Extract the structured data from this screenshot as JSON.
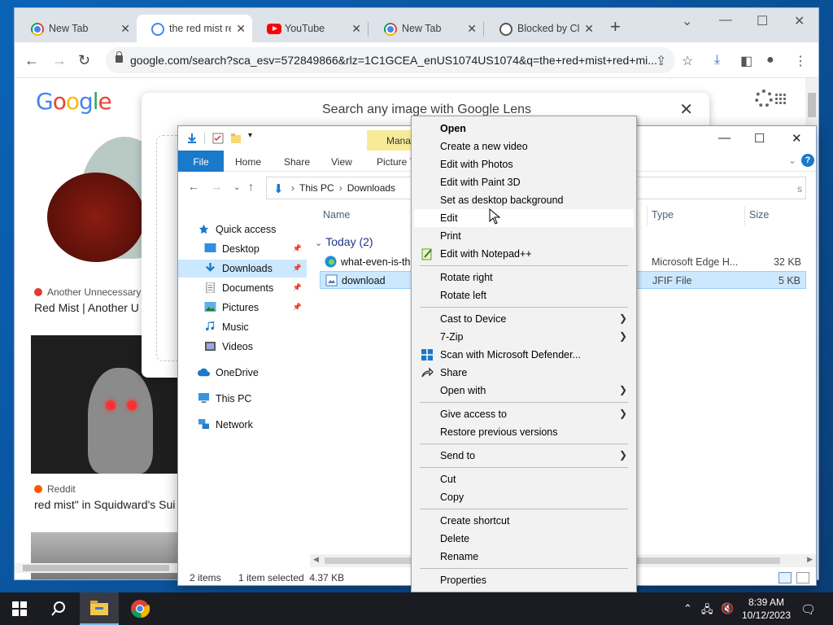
{
  "browser": {
    "tabs": [
      {
        "title": "New Tab",
        "icon": "chrome-icon"
      },
      {
        "title": "the red mist re",
        "icon": "google-icon"
      },
      {
        "title": "YouTube",
        "icon": "youtube-icon"
      },
      {
        "title": "New Tab",
        "icon": "chrome-icon"
      },
      {
        "title": "Blocked by Clo",
        "icon": "blocked-icon"
      }
    ],
    "url": "google.com/search?sca_esv=572849866&rlz=1C1GCEA_enUS1074US1074&q=the+red+mist+red+mi..."
  },
  "google": {
    "logo": [
      "G",
      "o",
      "o",
      "g",
      "l",
      "e"
    ],
    "lens_title": "Search any image with Google Lens",
    "result1_source": "Another Unnecessary",
    "result1_title": "Red Mist | Another U",
    "result2_source": "Reddit",
    "result2_title": "red mist\" in Squidward's Sui"
  },
  "explorer": {
    "ribbon_tabs": [
      "File",
      "Home",
      "Share",
      "View",
      "Picture T"
    ],
    "manage_label": "Manag",
    "address": {
      "this_pc": "This PC",
      "sep": "›",
      "folder": "Downloads"
    },
    "search_placeholder": "s",
    "nav": [
      {
        "label": "Quick access",
        "icon": "star-icon"
      },
      {
        "label": "Desktop",
        "icon": "desktop-icon"
      },
      {
        "label": "Downloads",
        "icon": "downloads-icon"
      },
      {
        "label": "Documents",
        "icon": "documents-icon"
      },
      {
        "label": "Pictures",
        "icon": "pictures-icon"
      },
      {
        "label": "Music",
        "icon": "music-icon"
      },
      {
        "label": "Videos",
        "icon": "videos-icon"
      },
      {
        "label": "OneDrive",
        "icon": "onedrive-icon"
      },
      {
        "label": "This PC",
        "icon": "computer-icon"
      },
      {
        "label": "Network",
        "icon": "network-icon"
      }
    ],
    "columns": {
      "name": "Name",
      "type": "Type",
      "size": "Size"
    },
    "group_label": "Today (2)",
    "files": [
      {
        "name": "what-even-is-the",
        "type": "Microsoft Edge H...",
        "size": "32 KB"
      },
      {
        "name": "download",
        "type": "JFIF File",
        "size": "5 KB"
      }
    ],
    "status": {
      "items": "2 items",
      "selected": "1 item selected  4.37 KB"
    }
  },
  "context_menu": {
    "items": [
      {
        "label": "Open"
      },
      {
        "label": "Create a new video"
      },
      {
        "label": "Edit with Photos"
      },
      {
        "label": "Edit with Paint 3D"
      },
      {
        "label": "Set as desktop background"
      },
      {
        "label": "Edit"
      },
      {
        "label": "Print"
      },
      {
        "label": "Edit with Notepad++"
      },
      {
        "label": "Rotate right"
      },
      {
        "label": "Rotate left"
      },
      {
        "label": "Cast to Device"
      },
      {
        "label": "7-Zip"
      },
      {
        "label": "Scan with Microsoft Defender..."
      },
      {
        "label": "Share"
      },
      {
        "label": "Open with"
      },
      {
        "label": "Give access to"
      },
      {
        "label": "Restore previous versions"
      },
      {
        "label": "Send to"
      },
      {
        "label": "Cut"
      },
      {
        "label": "Copy"
      },
      {
        "label": "Create shortcut"
      },
      {
        "label": "Delete"
      },
      {
        "label": "Rename"
      },
      {
        "label": "Properties"
      }
    ]
  },
  "taskbar": {
    "time": "8:39 AM",
    "date": "10/12/2023"
  },
  "colors": {
    "accent": "#1979ca",
    "selection": "#cce8ff",
    "menu_bg": "#f2f2f2"
  }
}
